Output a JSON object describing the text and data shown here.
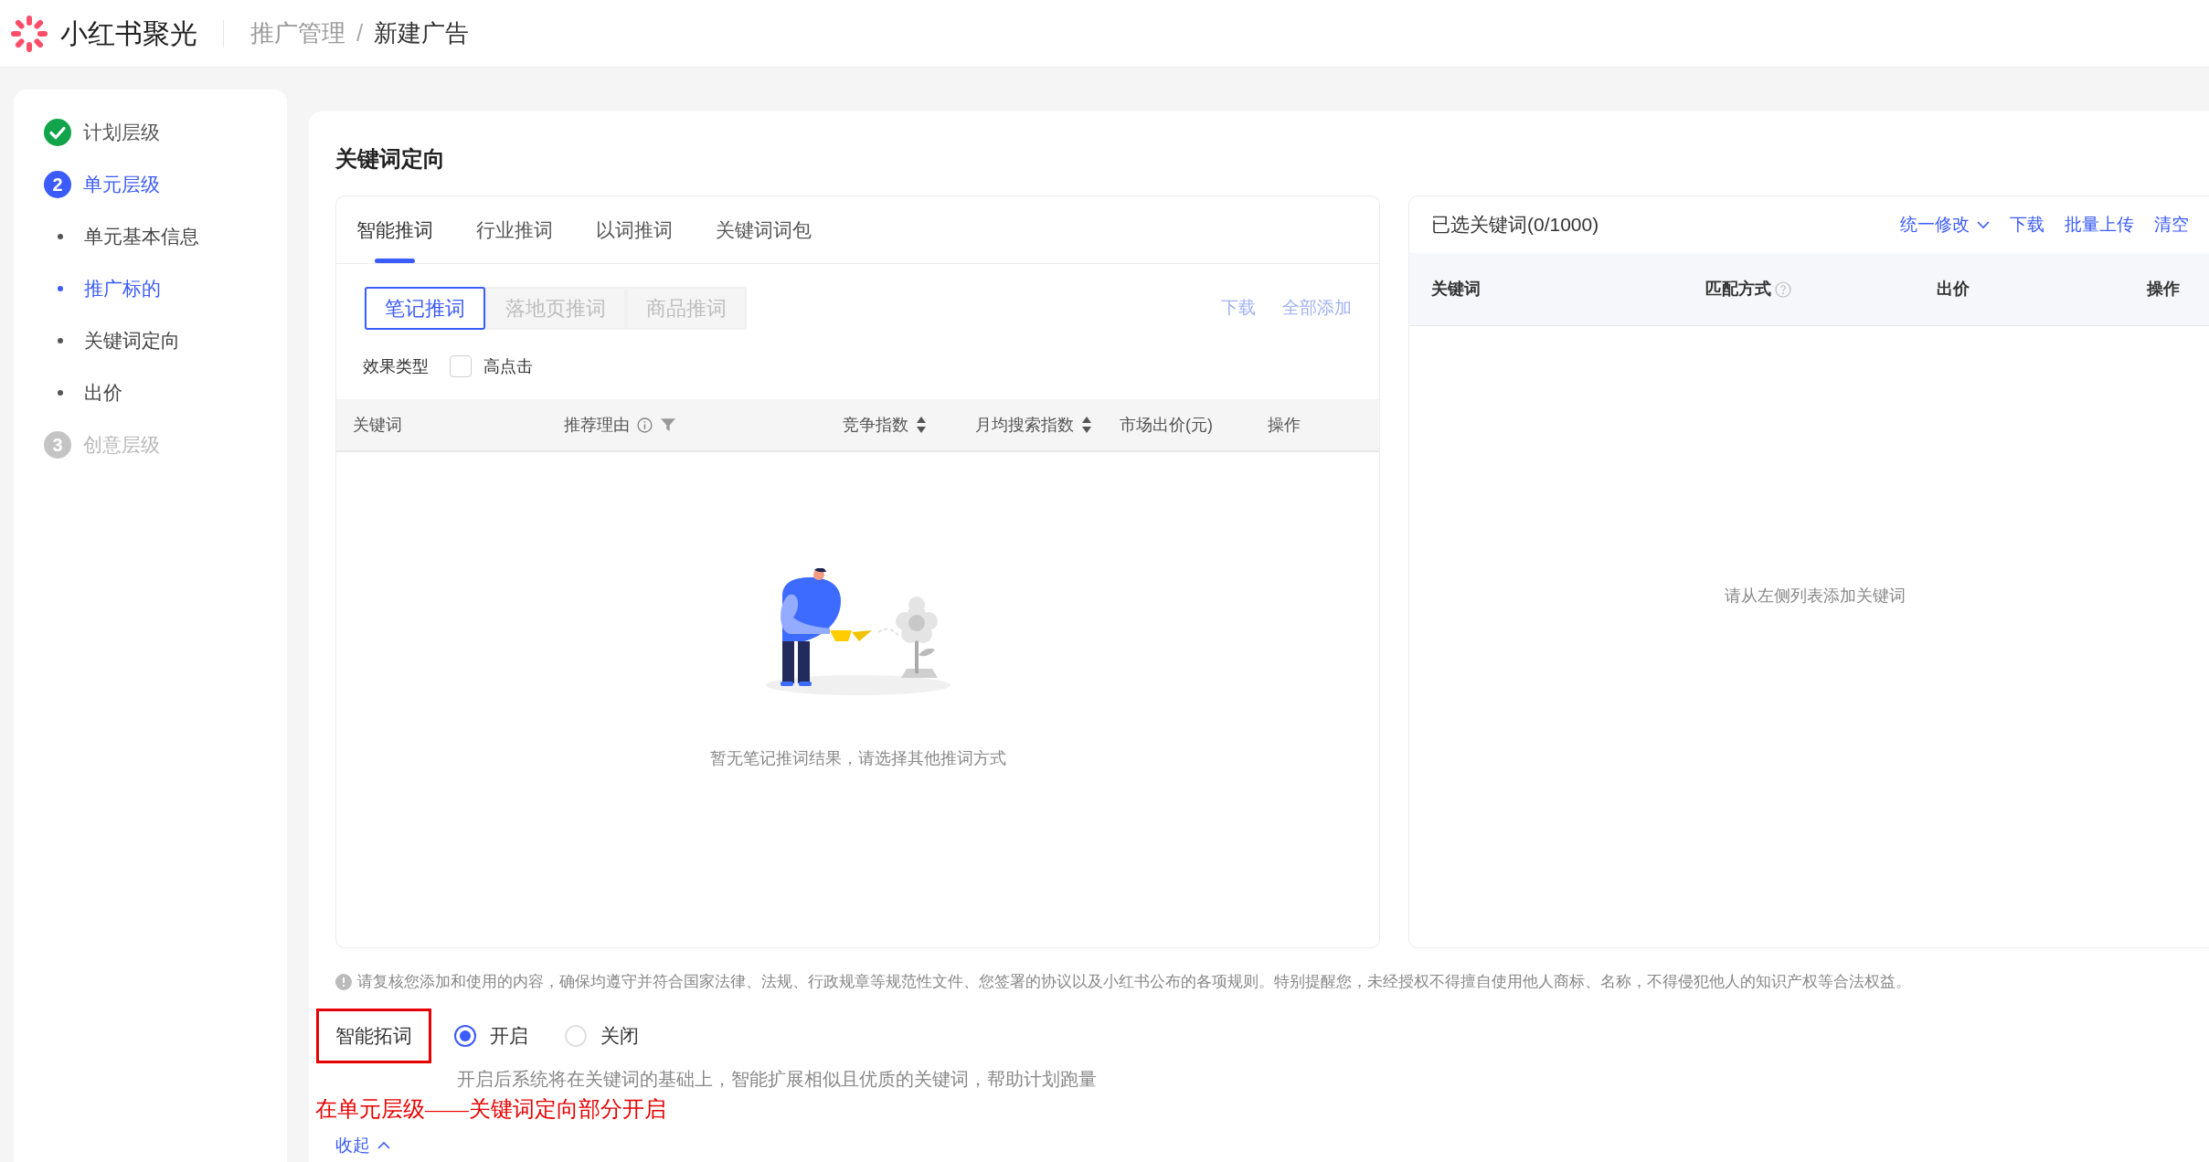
{
  "header": {
    "logo": "小红书聚光",
    "separator": "/",
    "breadcrumb": [
      {
        "label": "推广管理",
        "current": false
      },
      {
        "label": "新建广告",
        "current": true
      }
    ]
  },
  "sidebar": {
    "items": [
      {
        "kind": "done",
        "label": "计划层级"
      },
      {
        "kind": "current",
        "number": "2",
        "label": "单元层级"
      },
      {
        "kind": "sub",
        "label": "单元基本信息",
        "selected": false
      },
      {
        "kind": "sub",
        "label": "推广标的",
        "selected": true
      },
      {
        "kind": "sub",
        "label": "关键词定向",
        "selected": false
      },
      {
        "kind": "sub",
        "label": "出价",
        "selected": false
      },
      {
        "kind": "pending",
        "number": "3",
        "label": "创意层级"
      }
    ]
  },
  "section_title": "关键词定向",
  "left_panel": {
    "tabs": [
      {
        "label": "智能推词",
        "selected": true
      },
      {
        "label": "行业推词",
        "selected": false
      },
      {
        "label": "以词推词",
        "selected": false
      },
      {
        "label": "关键词词包",
        "selected": false
      }
    ],
    "sub_tabs": [
      {
        "label": "笔记推词",
        "selected": true
      },
      {
        "label": "落地页推词",
        "selected": false
      },
      {
        "label": "商品推词",
        "selected": false
      }
    ],
    "actions": [
      {
        "label": "下载",
        "disabled": true
      },
      {
        "label": "全部添加",
        "disabled": true
      }
    ],
    "filter": {
      "label": "效果类型",
      "option": {
        "label": "高点击",
        "checked": false
      }
    },
    "columns": [
      {
        "kind": "plain",
        "label": "关键词"
      },
      {
        "kind": "filterable",
        "label": "推荐理由"
      },
      {
        "kind": "sortable",
        "label": "竞争指数"
      },
      {
        "kind": "sortable",
        "label": "月均搜索指数"
      },
      {
        "kind": "plain",
        "label": "市场出价(元)"
      },
      {
        "kind": "plain",
        "label": "操作"
      }
    ],
    "empty_text": "暂无笔记推词结果，请选择其他推词方式"
  },
  "right_panel": {
    "title": "已选关键词(0/1000)",
    "actions": [
      {
        "kind": "dropdown",
        "label": "统一修改"
      },
      {
        "kind": "link",
        "label": "下载"
      },
      {
        "kind": "link",
        "label": "批量上传"
      },
      {
        "kind": "link",
        "label": "清空"
      }
    ],
    "columns": [
      {
        "kind": "plain",
        "label": "关键词"
      },
      {
        "kind": "help",
        "label": "匹配方式"
      },
      {
        "kind": "plain",
        "label": "出价"
      },
      {
        "kind": "plain",
        "label": "操作"
      }
    ],
    "empty_text": "请从左侧列表添加关键词"
  },
  "notice": "请复核您添加和使用的内容，确保均遵守并符合国家法律、法规、行政规章等规范性文件、您签署的协议以及小红书公布的各项规则。特别提醒您，未经授权不得擅自使用他人商标、名称，不得侵犯他人的知识产权等合法权益。",
  "smart_expand": {
    "label": "智能拓词",
    "highlighted": true,
    "options": [
      {
        "label": "开启",
        "selected": true
      },
      {
        "label": "关闭",
        "selected": false
      }
    ],
    "description": "开启后系统将在关键词的基础上，智能扩展相似且优质的关键词，帮助计划跑量"
  },
  "annotation": "在单元层级——关键词定向部分开启",
  "collapse": {
    "label": "收起",
    "expanded": true
  }
}
